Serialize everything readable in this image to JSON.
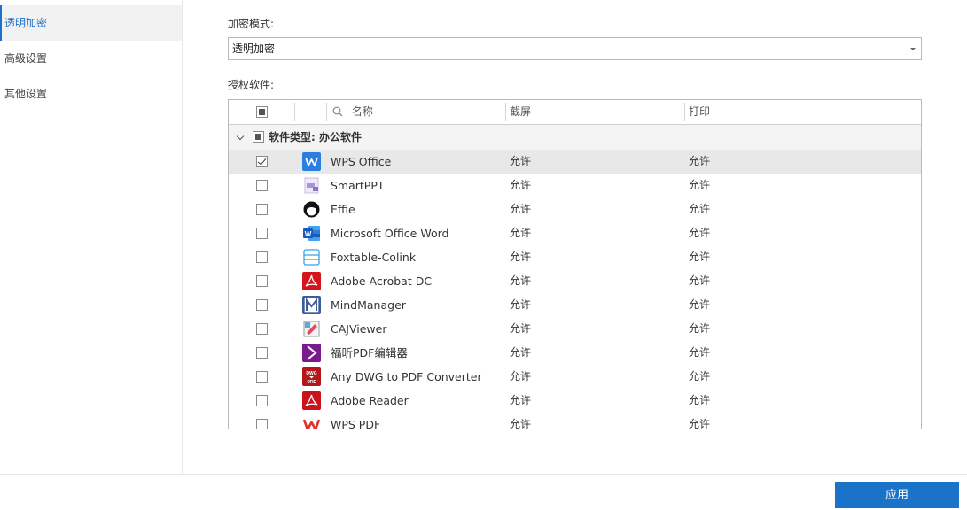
{
  "sidebar": {
    "items": [
      {
        "label": "透明加密",
        "active": true
      },
      {
        "label": "高级设置",
        "active": false
      },
      {
        "label": "其他设置",
        "active": false
      }
    ]
  },
  "mode": {
    "label": "加密模式:",
    "value": "透明加密"
  },
  "software": {
    "label": "授权软件:",
    "columns": {
      "name": "名称",
      "screenshot": "截屏",
      "print": "打印"
    },
    "group": "软件类型: 办公软件",
    "rows": [
      {
        "name": "WPS Office",
        "screenshot": "允许",
        "print": "允许",
        "checked": true,
        "icon": "wps-office-icon"
      },
      {
        "name": "SmartPPT",
        "screenshot": "允许",
        "print": "允许",
        "checked": false,
        "icon": "smartppt-icon"
      },
      {
        "name": "Effie",
        "screenshot": "允许",
        "print": "允许",
        "checked": false,
        "icon": "effie-icon"
      },
      {
        "name": "Microsoft Office Word",
        "screenshot": "允许",
        "print": "允许",
        "checked": false,
        "icon": "word-icon"
      },
      {
        "name": "Foxtable-Colink",
        "screenshot": "允许",
        "print": "允许",
        "checked": false,
        "icon": "foxtable-icon"
      },
      {
        "name": "Adobe Acrobat DC",
        "screenshot": "允许",
        "print": "允许",
        "checked": false,
        "icon": "acrobat-icon"
      },
      {
        "name": "MindManager",
        "screenshot": "允许",
        "print": "允许",
        "checked": false,
        "icon": "mindmanager-icon"
      },
      {
        "name": "CAJViewer",
        "screenshot": "允许",
        "print": "允许",
        "checked": false,
        "icon": "cajviewer-icon"
      },
      {
        "name": "福昕PDF编辑器",
        "screenshot": "允许",
        "print": "允许",
        "checked": false,
        "icon": "foxit-icon"
      },
      {
        "name": "Any DWG to PDF Converter",
        "screenshot": "允许",
        "print": "允许",
        "checked": false,
        "icon": "dwg-pdf-icon"
      },
      {
        "name": "Adobe Reader",
        "screenshot": "允许",
        "print": "允许",
        "checked": false,
        "icon": "adobe-reader-icon"
      },
      {
        "name": "WPS PDF",
        "screenshot": "允许",
        "print": "允许",
        "checked": false,
        "icon": "wps-pdf-icon"
      }
    ]
  },
  "footer": {
    "apply_label": "应用"
  },
  "colors": {
    "accent": "#1a73c9"
  }
}
